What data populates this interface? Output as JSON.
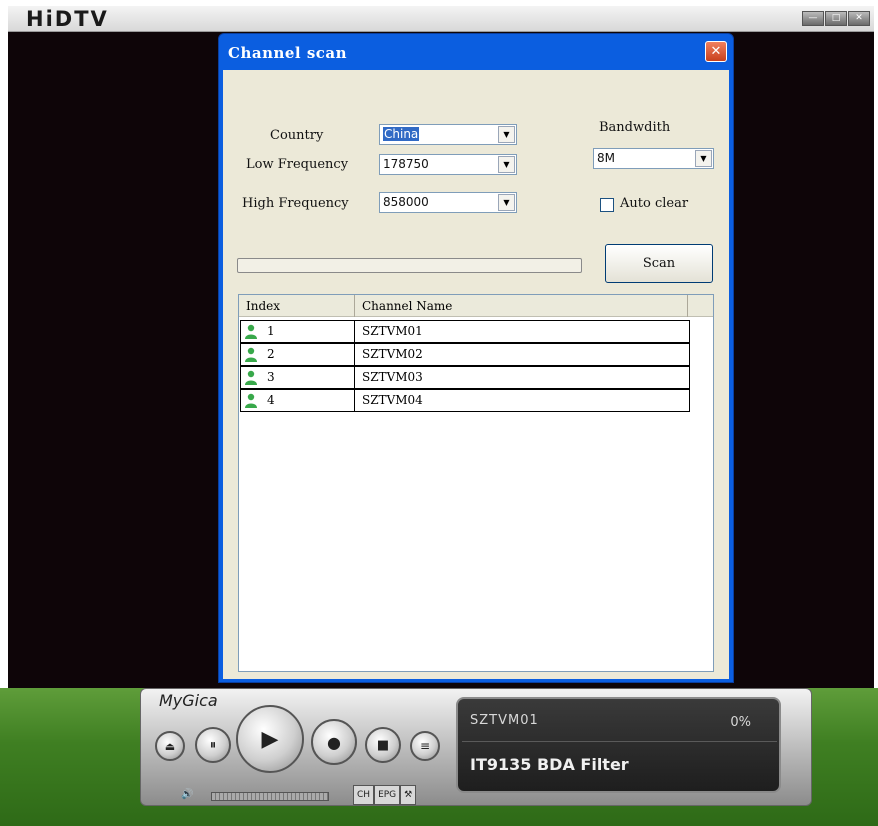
{
  "app": {
    "logo": "HiDTV",
    "controls": [
      "—",
      "□",
      "✕"
    ]
  },
  "dialog": {
    "title": "Channel scan",
    "close_glyph": "✕",
    "country": {
      "label": "Country",
      "value": "China"
    },
    "low_freq": {
      "label": "Low Frequency",
      "value": "178750"
    },
    "high_freq": {
      "label": "High Frequency",
      "value": "858000"
    },
    "bandwidth": {
      "label": "Bandwdith",
      "value": "8M"
    },
    "auto_clear": {
      "label": "Auto clear",
      "checked": false
    },
    "progress": 0,
    "scan_label": "Scan",
    "list": {
      "headers": [
        "Index",
        "Channel Name"
      ],
      "rows": [
        {
          "index": "1",
          "name": "SZTVM01"
        },
        {
          "index": "2",
          "name": "SZTVM02"
        },
        {
          "index": "3",
          "name": "SZTVM03"
        },
        {
          "index": "4",
          "name": "SZTVM04"
        }
      ]
    }
  },
  "player": {
    "brand": "MyGica",
    "buttons": {
      "open": "⏏",
      "pause": "⏸",
      "play": "▶",
      "record": "●",
      "stop": "■",
      "menu": "≡"
    },
    "display": {
      "channel": "SZTVM01",
      "percent": "0%",
      "filter": "IT9135 BDA Filter"
    },
    "volume_icon": "🔊",
    "tabs": [
      "CH",
      "EPG",
      "⚒"
    ]
  },
  "colors": {
    "dialog_title": "#0b5ee0",
    "dialog_body": "#ece9d8",
    "video_bg": "#0e0508"
  }
}
